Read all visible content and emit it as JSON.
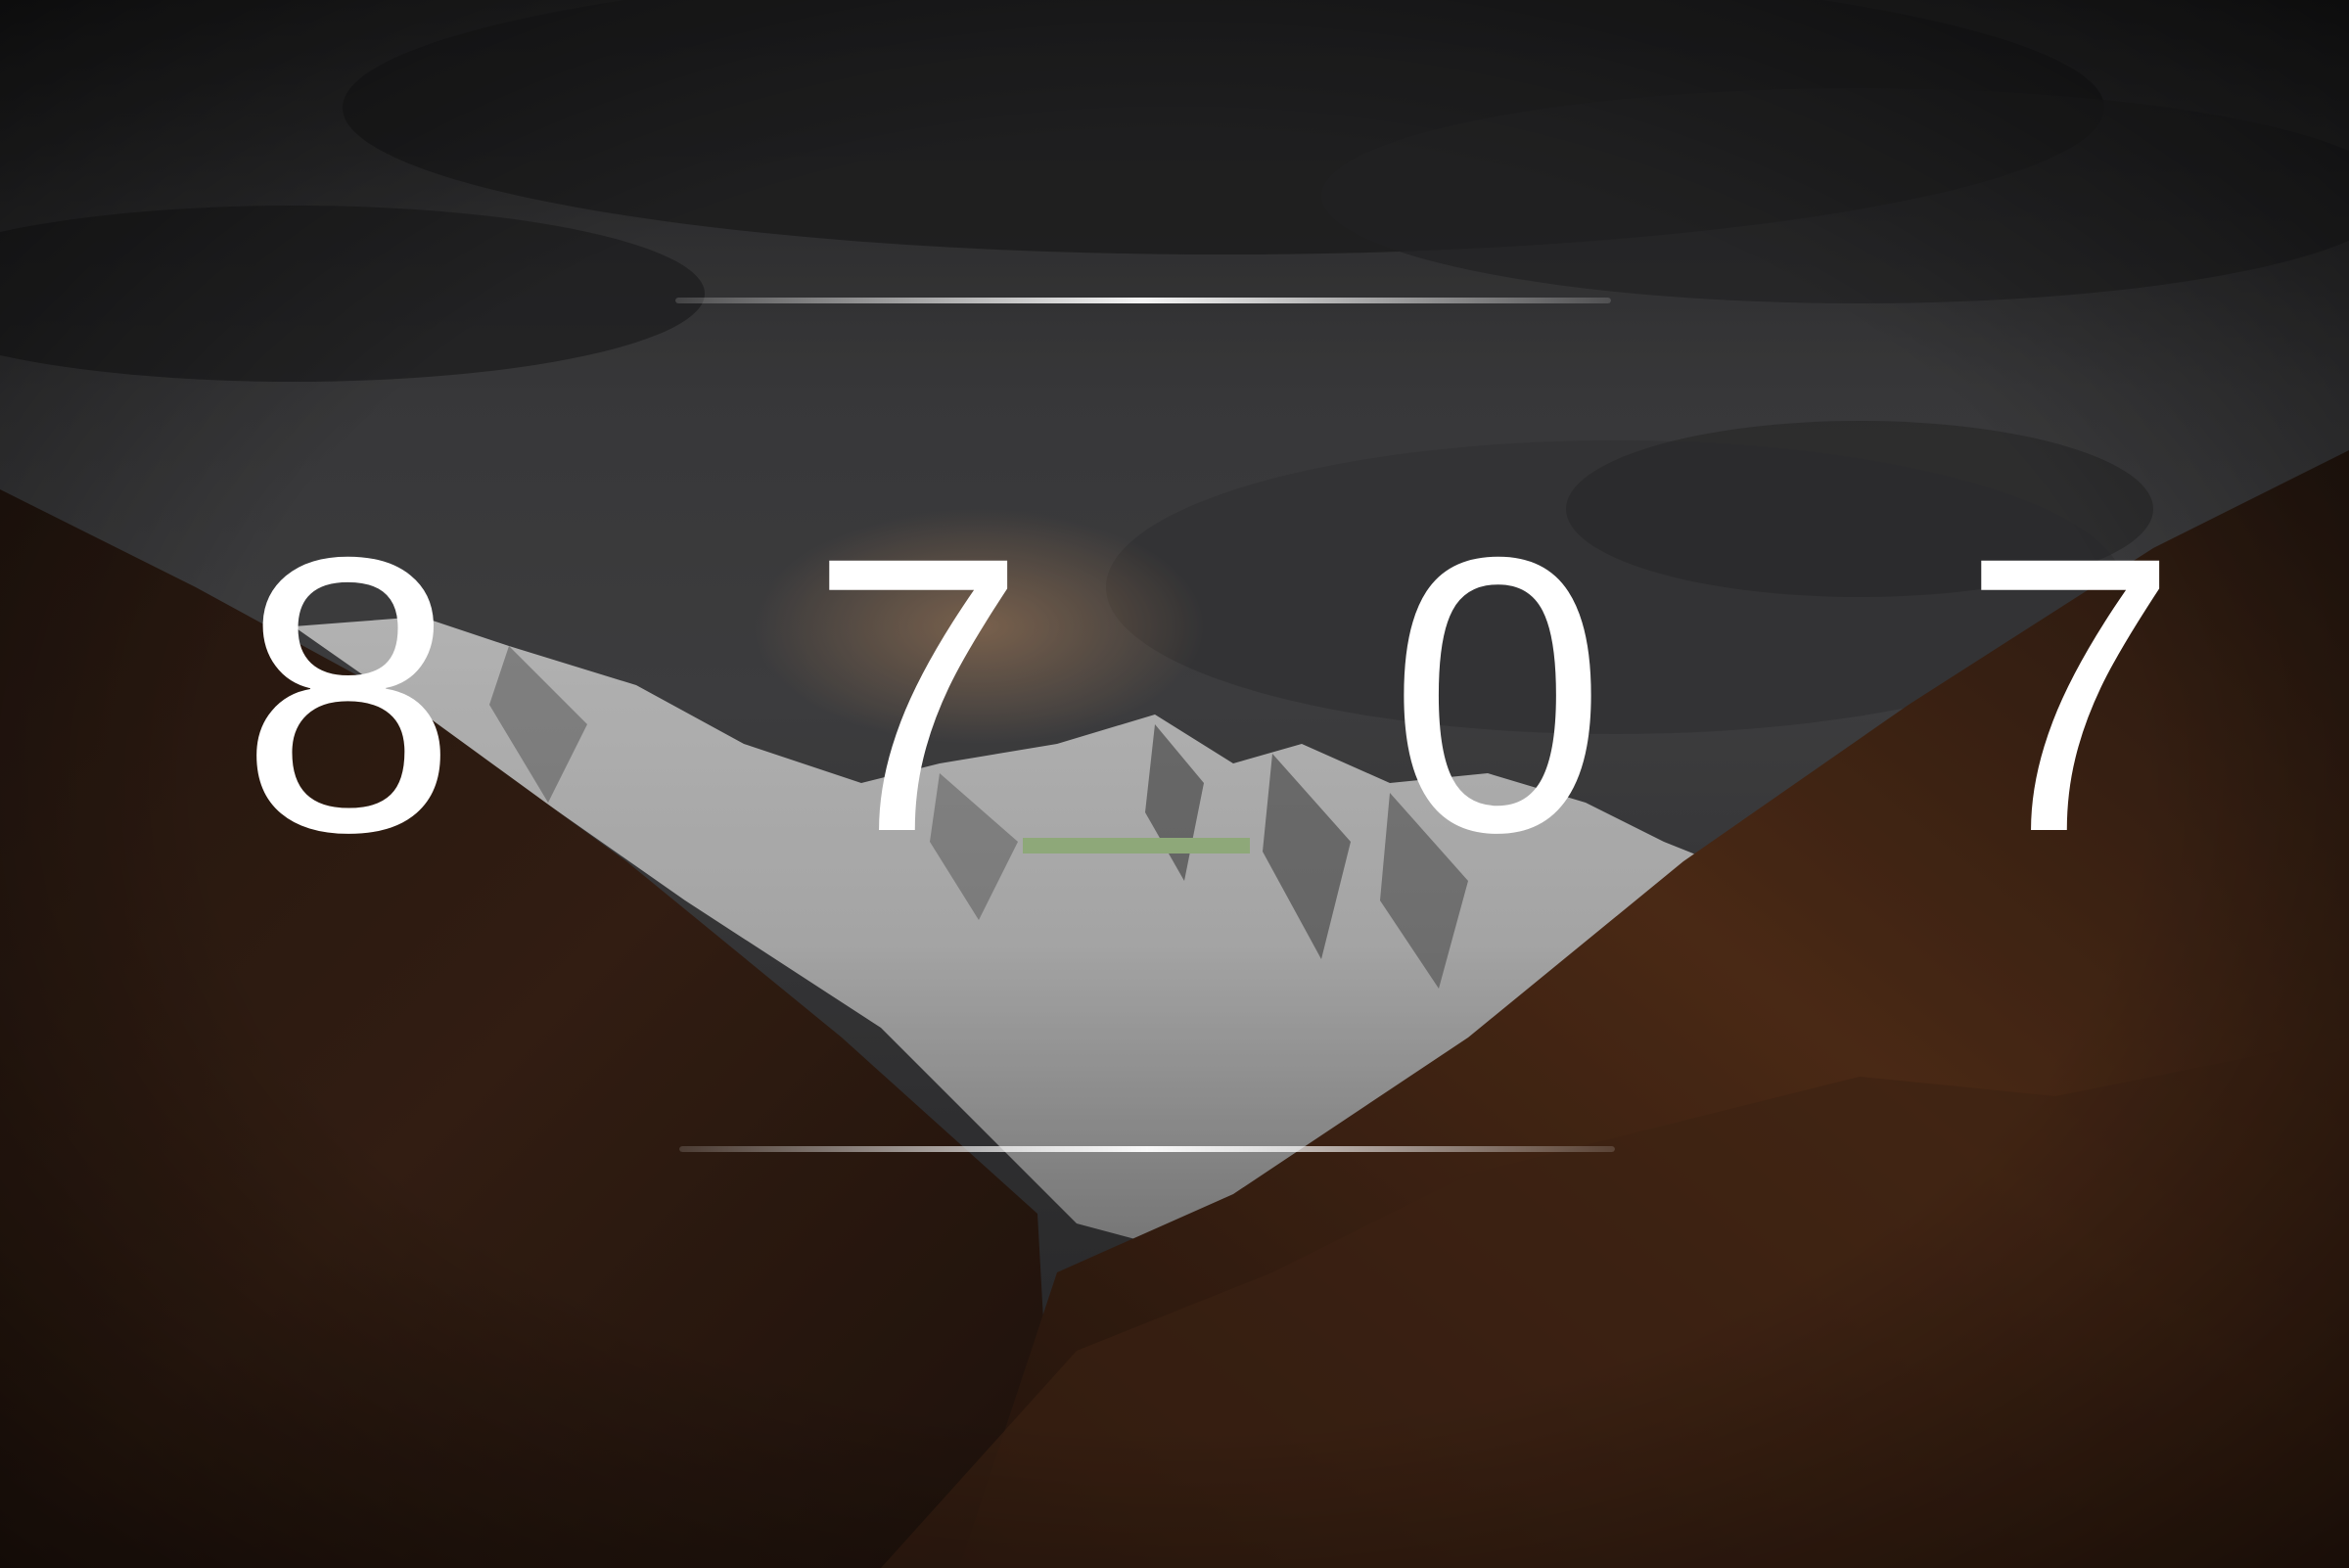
{
  "code_entry": {
    "digits": [
      "8",
      "7",
      "0",
      "7"
    ],
    "active_index": 2
  },
  "colors": {
    "digit_text": "#ffffff",
    "active_cursor": "#8ea879",
    "divider_line": "#f2f2f2",
    "sky": "#3b3b3d",
    "snow": "#e6e6e6",
    "forest": "#4a2a17"
  },
  "background": {
    "scene": "snow-capped-mountain-with-autumn-forest"
  }
}
